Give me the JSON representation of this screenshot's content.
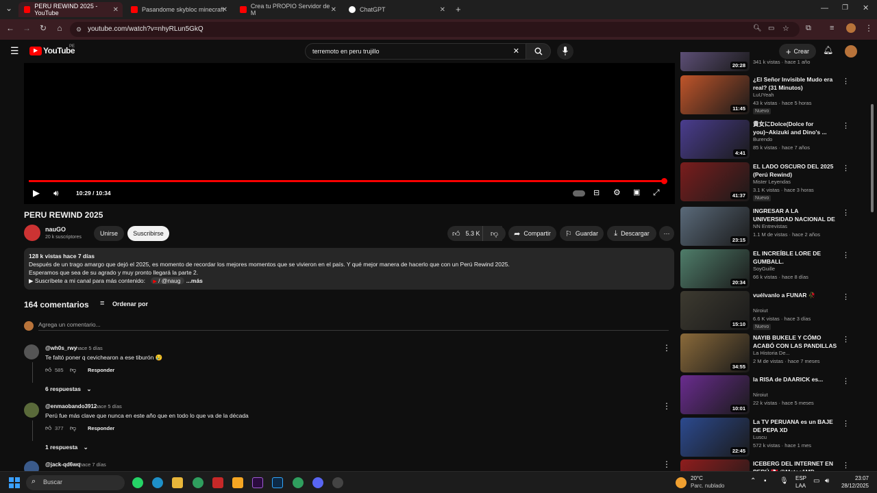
{
  "browser": {
    "tabs": [
      {
        "title": "PERU REWIND 2025 - YouTube",
        "active": true
      },
      {
        "title": "Pasandome skybloc minecraft",
        "active": false
      },
      {
        "title": "Crea tu PROPIO Servidor de M",
        "active": false
      },
      {
        "title": "ChatGPT",
        "active": false
      }
    ],
    "url": "youtube.com/watch?v=nhyRLun5GkQ"
  },
  "header": {
    "logo": "YouTube",
    "region": "PE",
    "search_value": "terremoto en peru trujillo",
    "create_label": "Crear"
  },
  "player": {
    "time": "10:29 / 10:34",
    "progress": 0.99
  },
  "video": {
    "title": "PERU REWIND 2025",
    "channel": "nauGO",
    "subscribers": "20 k suscriptores",
    "join_label": "Unirse",
    "subscribe_label": "Suscribirse",
    "likes": "5.3 K",
    "share_label": "Compartir",
    "save_label": "Guardar",
    "download_label": "Descargar"
  },
  "description": {
    "stats": "128 k vistas  hace 7 días",
    "line1": "Después de un trago amargo que dejó el 2025, es momento de recordar los mejores momentos que se vivieron en el país. Y qué mejor manera de hacerlo que con un Perú Rewind 2025.",
    "line2": "Esperamos que sea de su agrado y muy pronto llegará la parte 2.",
    "line3": "▶ Suscríbete a mi canal para más contenido:",
    "link": "/ @naug",
    "more": "...más"
  },
  "comments": {
    "count_label": "164 comentarios",
    "sort_label": "Ordenar por",
    "add_placeholder": "Agrega un comentario...",
    "reply_label": "Responder",
    "items": [
      {
        "author": "@wh0s_rwy",
        "time": "hace 5 días",
        "text": "Te faltó poner q cevichearon a ese tiburón 😢",
        "likes": "585",
        "replies": "6 respuestas"
      },
      {
        "author": "@enmaobando3912",
        "time": "hace 5 días",
        "text": "Perú fue más clave que nunca en este año que en todo lo que va de la década",
        "likes": "377",
        "replies": "1 respuesta"
      },
      {
        "author": "@jack-qd6wq",
        "time": "hace 7 días"
      }
    ]
  },
  "sidebar": {
    "items": [
      {
        "title": "",
        "channel": "",
        "meta": "341 k vistas · hace 1 año",
        "duration": "20:28",
        "thumb_color": "#6b5a8a"
      },
      {
        "title": "¿El Señor Invisible Mudo era real? (31 Minutos)",
        "channel": "LuUYeah",
        "meta": "43 k vistas · hace 5 horas",
        "badge": "Nuevo",
        "duration": "11:45",
        "thumb_color": "#c0552a"
      },
      {
        "title": "貴女にDolce(Dolce for you)~Akizuki and Dino's ...",
        "channel": "Burendo",
        "meta": "85 k vistas · hace 7 años",
        "duration": "4:41",
        "thumb_color": "#4a3d8f"
      },
      {
        "title": "EL LADO OSCURO DEL 2025 (Perú Rewind)",
        "channel": "Mister Leyendas",
        "meta": "3.1 K vistas · hace 3 horas",
        "badge": "Nuevo",
        "duration": "41:37",
        "thumb_color": "#7a1d1d"
      },
      {
        "title": "INGRESAR A LA UNIVERSIDAD NACIONAL DE INGENIERÍA ES ...",
        "channel": "NN Entrevistas",
        "meta": "1.1 M de vistas · hace 2 años",
        "duration": "23:15",
        "thumb_color": "#5a6a7a"
      },
      {
        "title": "EL INCREÍBLE LORE DE GUMBALL.",
        "channel": "SoyGuille",
        "meta": "66 k vistas · hace 8 días",
        "duration": "20:34",
        "thumb_color": "#4f7d6a"
      },
      {
        "title": "vuélvanlo a FUNAR 🥀",
        "channel": "Niroiut",
        "meta": "6.6 K vistas · hace 3 días",
        "badge": "Nuevo",
        "duration": "15:10",
        "thumb_color": "#3d3a30"
      },
      {
        "title": "NAYIB BUKELE Y CÓMO ACABÓ CON LAS PANDILLAS EN EL ...",
        "channel": "La Historia De...",
        "meta": "2 M de vistas · hace 7 meses",
        "duration": "34:55",
        "thumb_color": "#8a6a3a"
      },
      {
        "title": "la RISA de DAARICK es...",
        "channel": "Niroiut",
        "meta": "22 k vistas · hace 5 meses",
        "duration": "10:01",
        "thumb_color": "#6a2c8f"
      },
      {
        "title": "La TV PERUANA es un BAJE DE PEPA XD",
        "channel": "Luscu",
        "meta": "572 k vistas · hace 1 mes",
        "duration": "22:45",
        "thumb_color": "#2c4a8f"
      },
      {
        "title": "ICEBERG DEL INTERNET EN PERÚ 🇵🇪 @Mateo1MD",
        "channel": "",
        "meta": "",
        "duration": "",
        "thumb_color": "#8f1d1d"
      }
    ]
  },
  "taskbar": {
    "search_label": "Buscar",
    "weather_temp": "20°C",
    "weather_desc": "Parc. nublado",
    "lang": "ESP",
    "lang2": "LAA",
    "time": "23:07",
    "date": "28/12/2025"
  }
}
